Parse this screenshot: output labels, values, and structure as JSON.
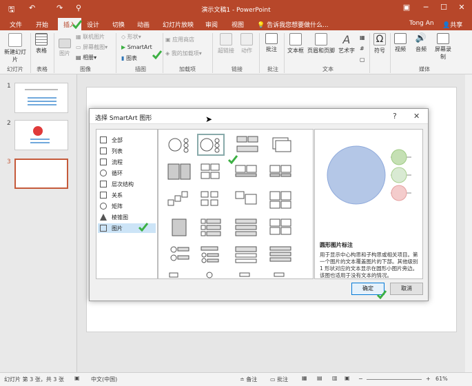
{
  "window": {
    "title": "演示文稿1 - PowerPoint",
    "user": "Tong An",
    "share": "共享"
  },
  "tabs": [
    "文件",
    "开始",
    "插入",
    "设计",
    "切换",
    "动画",
    "幻灯片放映",
    "审阅",
    "视图"
  ],
  "tell_me": "告诉我您想要做什么...",
  "ribbon": {
    "new_slide": "新建幻灯片",
    "table": "表格",
    "picture": "图片",
    "online_picture": "联机图片",
    "screenshot": "屏幕截图",
    "album": "相册",
    "shapes": "形状",
    "smartart": "SmartArt",
    "chart": "图表",
    "store": "应用商店",
    "my_addins": "我的加载项",
    "hyperlink": "超链接",
    "action": "动作",
    "comment": "批注",
    "textbox": "文本框",
    "header_footer": "页眉和页脚",
    "wordart": "艺术字",
    "symbol": "符号",
    "video": "视频",
    "audio": "音频",
    "screen_record": "屏幕录制",
    "groups": {
      "slides": "幻灯片",
      "tables": "表格",
      "images": "图像",
      "illustrations": "插图",
      "addins": "加载项",
      "links": "链接",
      "comments": "批注",
      "text": "文本",
      "media": "媒体"
    }
  },
  "thumbnails": [
    {
      "num": "1"
    },
    {
      "num": "2"
    },
    {
      "num": "3"
    }
  ],
  "dialog": {
    "title": "选择 SmartArt 图形",
    "help": "?",
    "close": "✕",
    "categories": [
      "全部",
      "列表",
      "流程",
      "循环",
      "层次结构",
      "关系",
      "矩阵",
      "棱锥图",
      "图片"
    ],
    "selected_category": "图片",
    "preview_name": "圆形图片标注",
    "preview_desc": "用于显示中心构思和子构思或相关项目。第一个图片的文本覆盖图片的下部。其他级别 1 形状对应的文本显示在圆形小图片旁边。该图也适用于没有文本的情况。",
    "ok": "确定",
    "cancel": "取消"
  },
  "status": {
    "slide_info": "幻灯片 第 3 张，共 3 张",
    "language": "中文(中国)",
    "notes": "备注",
    "comments": "批注",
    "zoom": "61%"
  },
  "colors": {
    "accent": "#b7472a",
    "check": "#3cb043",
    "preview_big": "#b4c7e7",
    "preview_green": "#c5e0b4",
    "preview_lightgreen": "#d9ead3",
    "preview_pink": "#f4cccc"
  }
}
